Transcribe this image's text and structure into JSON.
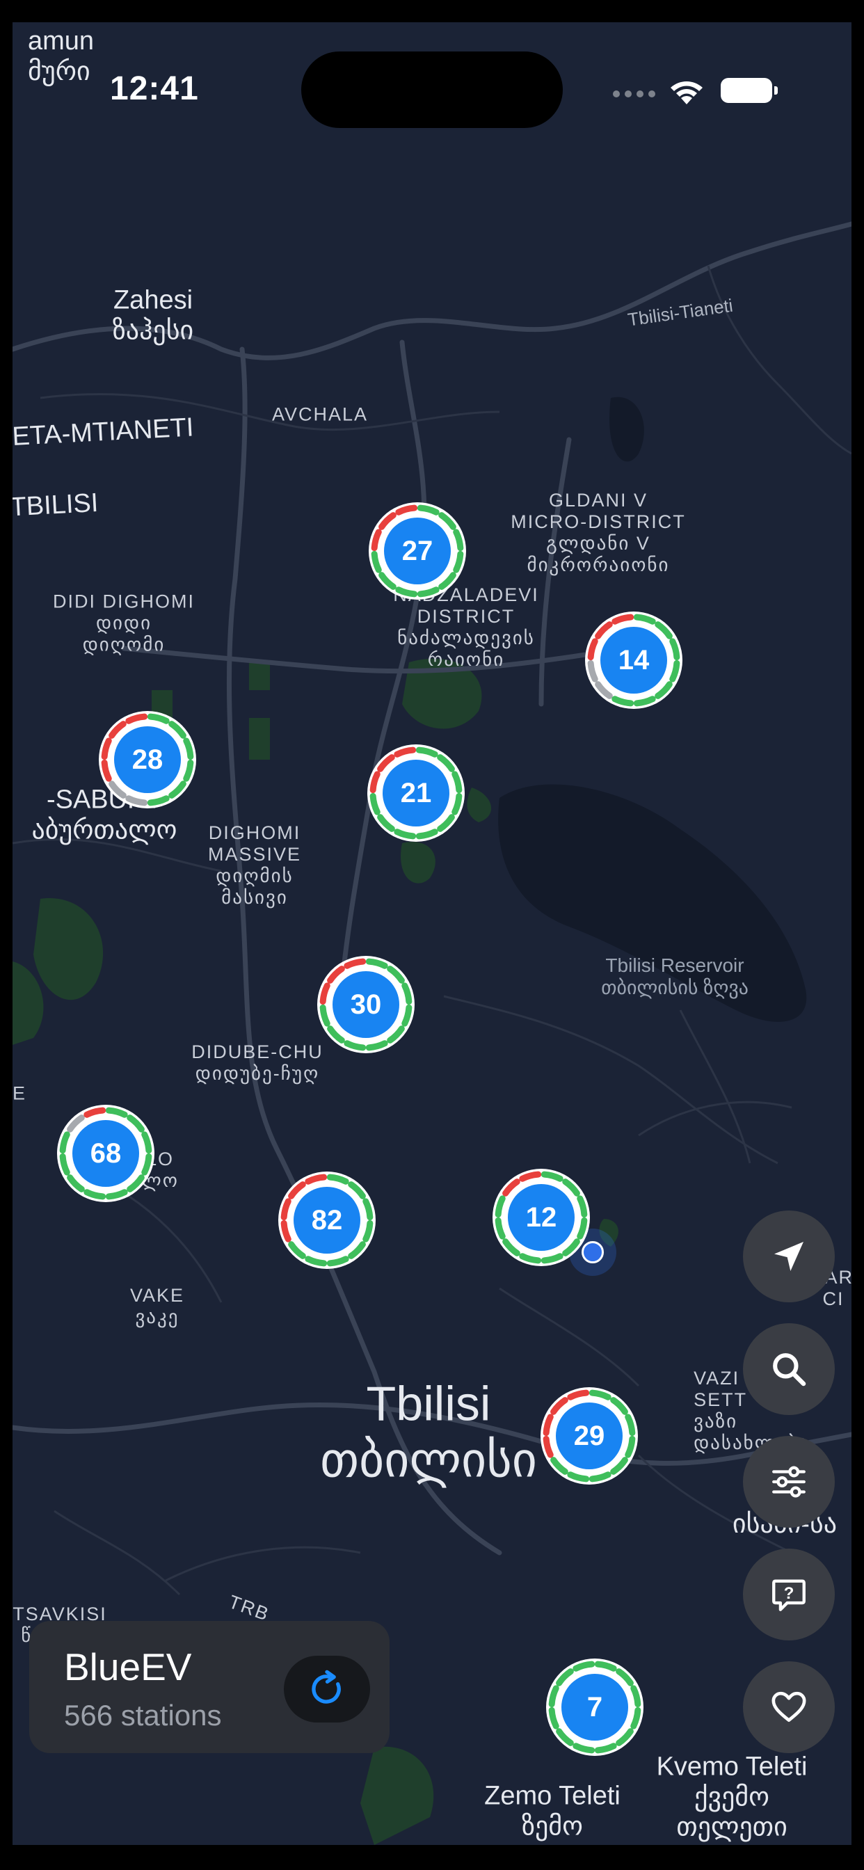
{
  "status_bar": {
    "time": "12:41"
  },
  "map": {
    "labels": {
      "top_left_1": "amun",
      "top_left_2": "მური",
      "zahesi": "Zahesi",
      "zahesi_ka": "ზაჰესი",
      "road_tianeti": "Tbilisi-Tianeti",
      "avchala": "AVCHALA",
      "mtskheta": "ETA-MTIANETI",
      "tbilisi_region": "TBILISI",
      "gldani_1": "GLDANI V",
      "gldani_2": "MICRO-DISTRICT",
      "gldani_3": "გლდანი V",
      "gldani_4": "მიკრორაიონი",
      "didi_1": "DIDI DIGHOMI",
      "didi_2": "დიდი",
      "didi_3": "დიღომი",
      "nadz_1": "NADZALADEVI",
      "nadz_2": "DISTRICT",
      "nadz_3": "ნაძალადევის",
      "nadz_4": "რაიონი",
      "saburt_1": "-SABURT",
      "saburt_2": "აბურთალო",
      "dighomi_1": "DIGHOMI",
      "dighomi_2": "MASSIVE",
      "dighomi_3": "დიღმის",
      "dighomi_4": "მასივი",
      "reservoir_1": "Tbilisi Reservoir",
      "reservoir_2": "თბილისის ზღვა",
      "didube_1": "DIDUBE-CHU",
      "didube_2": "დიდუბე-ჩუღ",
      "left_e": "E",
      "left_lo": "LO",
      "left_lo_ka": "ლო",
      "vake": "VAKE",
      "vake_ka": "ვაკე",
      "tbilisi": "Tbilisi",
      "tbilisi_ka": "თბილისი",
      "vazi_1": "VAZI",
      "vazi_2": "SETT",
      "vazi_3": "ვაზი",
      "vazi_4": "დასახლება",
      "right_1": "TAR",
      "right_2": "CI",
      "right_3": "ისანი-სა",
      "tsavkisi": "TSAVKISI",
      "tsavkisi_ka": "წავკისი",
      "trb": "TRB",
      "zemo": "Zemo Teleti",
      "zemo_ka": "ზემო",
      "kvemo": "Kvemo Teleti",
      "kvemo_ka_1": "ქვემო",
      "kvemo_ka_2": "თელეთი"
    },
    "clusters": [
      {
        "count": "27",
        "available": 0.72,
        "occupied": 0.28,
        "offline": 0.0
      },
      {
        "count": "14",
        "available": 0.58,
        "occupied": 0.25,
        "offline": 0.17
      },
      {
        "count": "28",
        "available": 0.55,
        "occupied": 0.3,
        "offline": 0.15
      },
      {
        "count": "21",
        "available": 0.75,
        "occupied": 0.25,
        "offline": 0.0
      },
      {
        "count": "30",
        "available": 0.72,
        "occupied": 0.28,
        "offline": 0.0
      },
      {
        "count": "68",
        "available": 0.78,
        "occupied": 0.12,
        "offline": 0.1
      },
      {
        "count": "82",
        "available": 0.7,
        "occupied": 0.3,
        "offline": 0.0
      },
      {
        "count": "12",
        "available": 0.8,
        "occupied": 0.2,
        "offline": 0.0
      },
      {
        "count": "29",
        "available": 0.68,
        "occupied": 0.32,
        "offline": 0.0
      },
      {
        "count": "7",
        "available": 1.0,
        "occupied": 0.0,
        "offline": 0.0
      }
    ],
    "colors": {
      "available": "#3fbe5b",
      "occupied": "#e8403c",
      "offline": "#a6a9ae",
      "cluster_fill": "#1884f2",
      "user_location": "#2f6fe8"
    }
  },
  "buttons": {
    "locate": "location-arrow-icon",
    "search": "search-icon",
    "filter": "sliders-icon",
    "help": "help-bubble-icon",
    "favorites": "heart-icon"
  },
  "info_card": {
    "title": "BlueEV",
    "subtitle": "566 stations",
    "refresh_icon": "refresh-icon"
  }
}
